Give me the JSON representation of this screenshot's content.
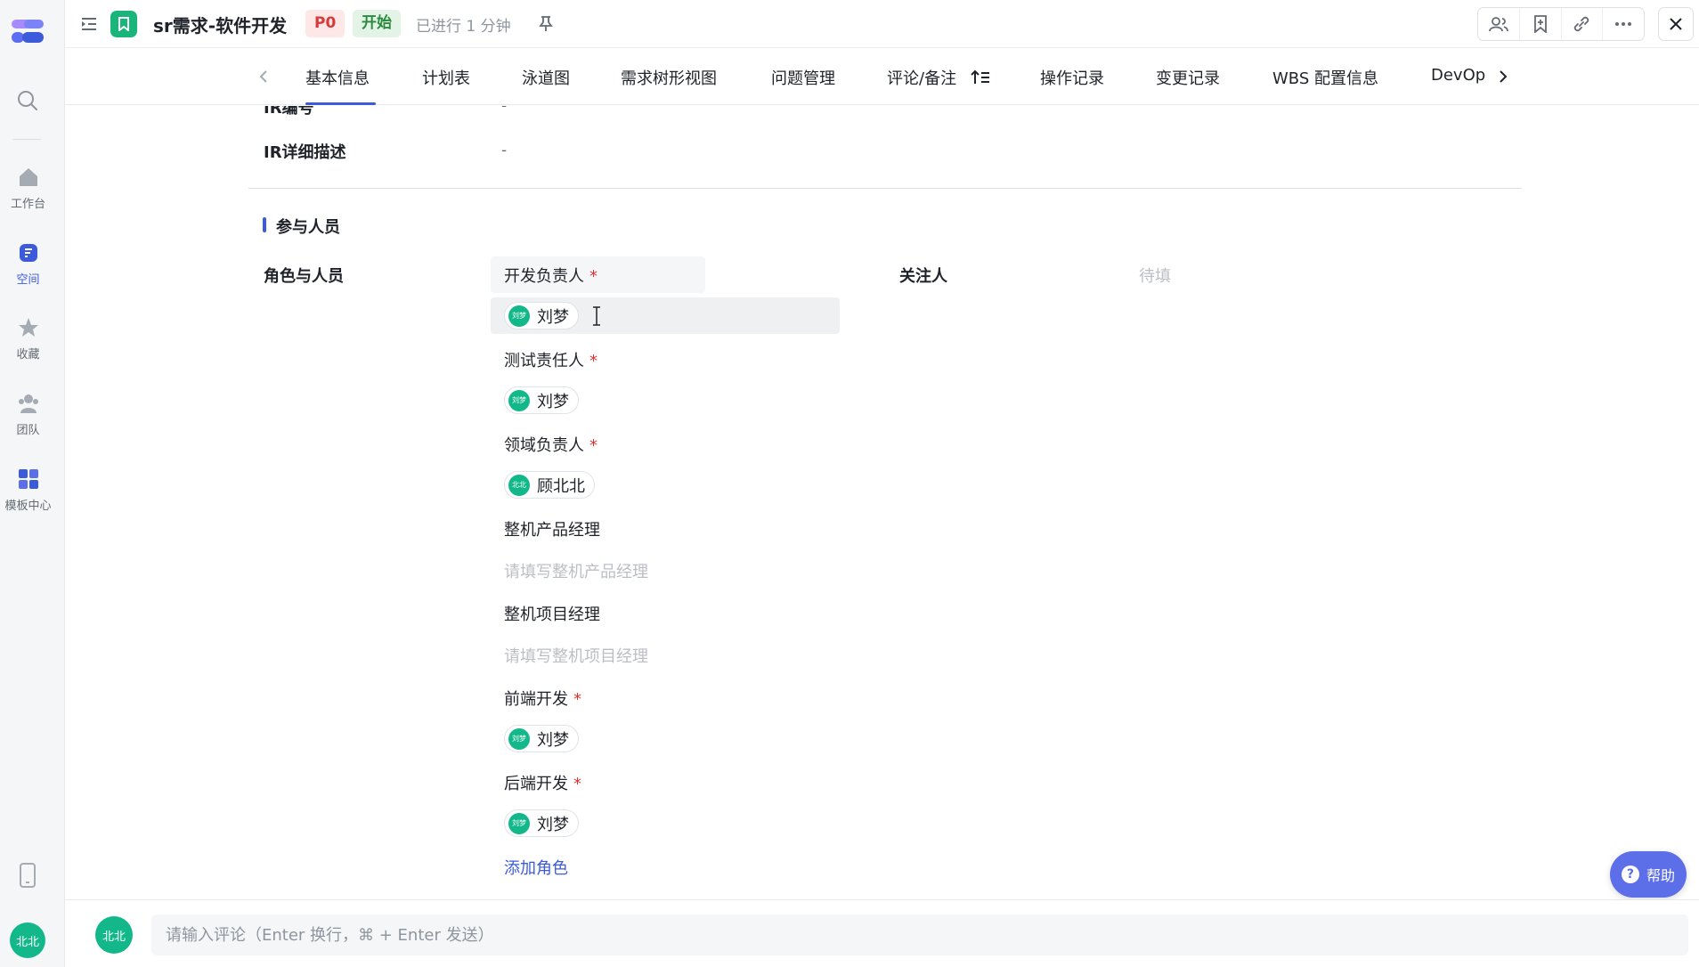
{
  "rail": {
    "items": [
      {
        "label": "工作台",
        "icon": "home-icon"
      },
      {
        "label": "空间",
        "icon": "space-icon"
      },
      {
        "label": "收藏",
        "icon": "star-icon"
      },
      {
        "label": "团队",
        "icon": "team-icon"
      },
      {
        "label": "模板中心",
        "icon": "template-icon"
      }
    ],
    "avatar": "北北"
  },
  "header": {
    "title": "sr需求-软件开发",
    "priority": "P0",
    "status": "开始",
    "elapsed": "已进行 1 分钟"
  },
  "tabs": [
    "基本信息",
    "计划表",
    "泳道图",
    "需求树形视图",
    "问题管理",
    "评论/备注",
    "操作记录",
    "变更记录",
    "WBS 配置信息",
    "DevOp"
  ],
  "fields": {
    "ir_no_label": "IR编号",
    "ir_no_value": "-",
    "ir_desc_label": "IR详细描述",
    "ir_desc_value": "-"
  },
  "section": {
    "title": "参与人员",
    "roles_label": "角色与人员",
    "watchers_label": "关注人",
    "watchers_value": "待填"
  },
  "roles": [
    {
      "name": "开发负责人",
      "required": "*",
      "person": "刘梦",
      "avatar": "刘梦"
    },
    {
      "name": "测试责任人",
      "required": "*",
      "person": "刘梦",
      "avatar": "刘梦"
    },
    {
      "name": "领域负责人",
      "required": "*",
      "person": "顾北北",
      "avatar": "北北"
    },
    {
      "name": "整机产品经理",
      "placeholder": "请填写整机产品经理"
    },
    {
      "name": "整机项目经理",
      "placeholder": "请填写整机项目经理"
    },
    {
      "name": "前端开发",
      "required": "*",
      "person": "刘梦",
      "avatar": "刘梦"
    },
    {
      "name": "后端开发",
      "required": "*",
      "person": "刘梦",
      "avatar": "刘梦"
    }
  ],
  "add_role": "添加角色",
  "help": "帮助",
  "comment": {
    "avatar": "北北",
    "placeholder": "请输入评论（Enter 换行，⌘ + Enter 发送）"
  },
  "colors": {
    "accent": "#3b5bdb",
    "avatar_green": "#13b88a",
    "required_red": "#e03131"
  }
}
